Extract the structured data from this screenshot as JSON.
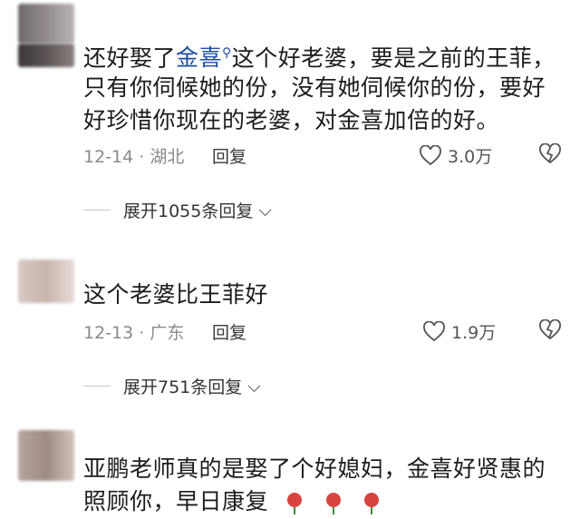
{
  "comments": [
    {
      "text_before": "还好娶了",
      "link": "金喜",
      "text_after": "这个好老婆，要是之前的王菲，",
      "line2": "只有你伺候她的份，没有她伺候你的份，要好",
      "line3": "好珍惜你现在的老婆，对金喜加倍的好。",
      "date": "12-14",
      "location": "湖北",
      "reply_label": "回复",
      "likes": "3.0万",
      "expand_label": "展开1055条回复"
    },
    {
      "line1": "这个老婆比王菲好",
      "date": "12-13",
      "location": "广东",
      "reply_label": "回复",
      "likes": "1.9万",
      "expand_label": "展开751条回复"
    },
    {
      "line1": "亚鹏老师真的是娶了个好媳妇，金喜好贤惠的",
      "line2": "照顾你，早日康复"
    }
  ],
  "colors": {
    "link": "#1d4fa0",
    "meta": "#8a8a8a",
    "rose": "#d9433f"
  }
}
